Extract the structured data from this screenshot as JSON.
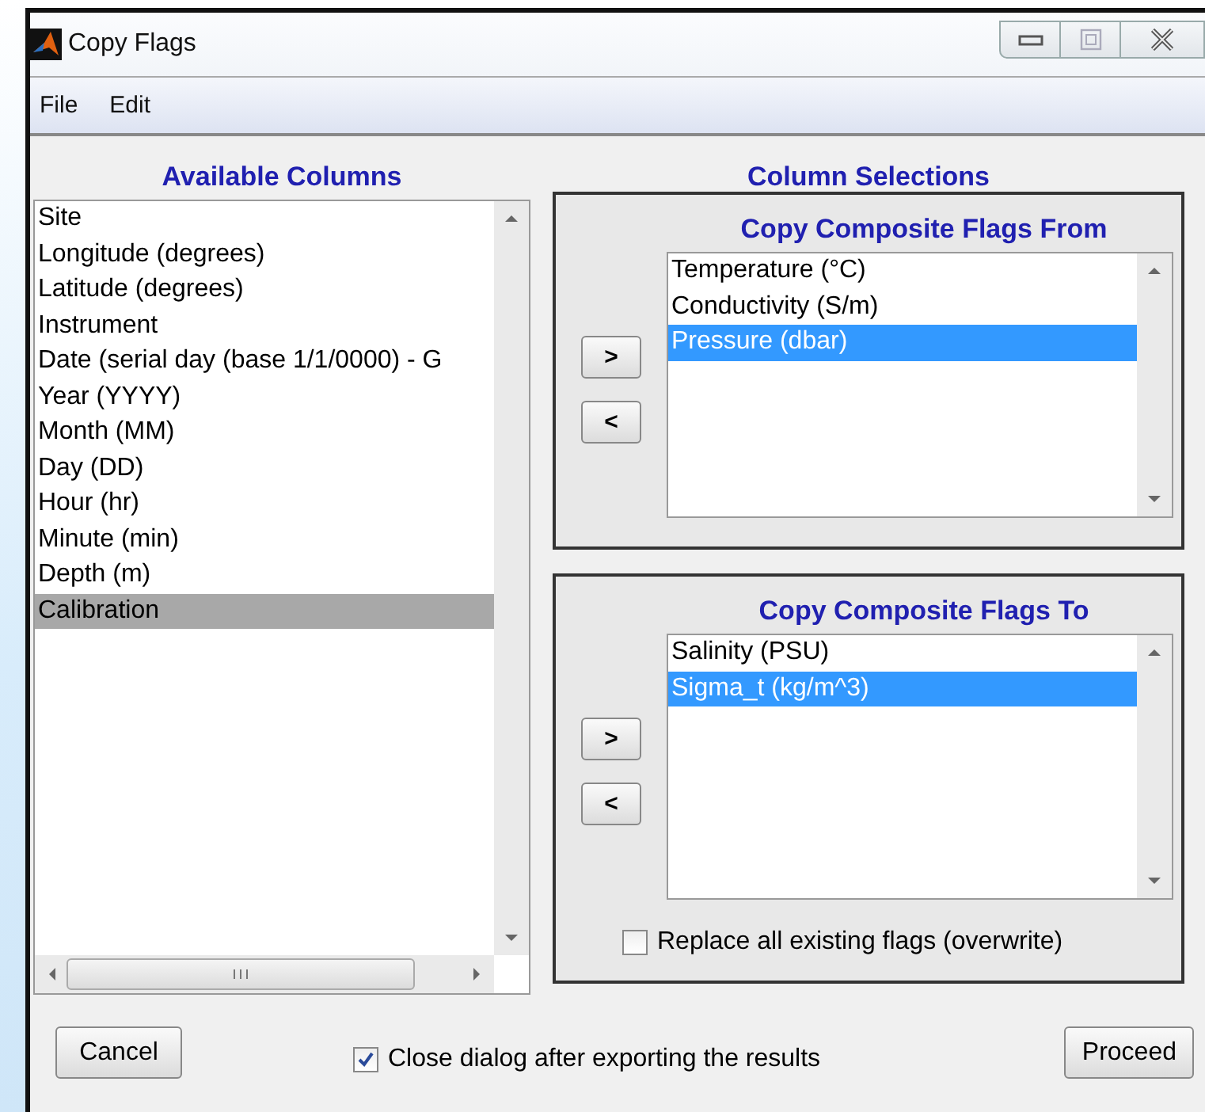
{
  "window": {
    "title": "Copy Flags"
  },
  "menu": [
    "File",
    "Edit"
  ],
  "available": {
    "heading": "Available Columns",
    "items": [
      {
        "label": "Site",
        "selected": false
      },
      {
        "label": "Longitude (degrees)",
        "selected": false
      },
      {
        "label": "Latitude (degrees)",
        "selected": false
      },
      {
        "label": "Instrument",
        "selected": false
      },
      {
        "label": "Date (serial day (base 1/1/0000) - G",
        "selected": false
      },
      {
        "label": "Year (YYYY)",
        "selected": false
      },
      {
        "label": "Month (MM)",
        "selected": false
      },
      {
        "label": "Day (DD)",
        "selected": false
      },
      {
        "label": "Hour (hr)",
        "selected": false
      },
      {
        "label": "Minute (min)",
        "selected": false
      },
      {
        "label": "Depth (m)",
        "selected": false
      },
      {
        "label": "Calibration",
        "selected": true
      }
    ]
  },
  "selections": {
    "heading": "Column Selections",
    "panels": [
      {
        "heading": "Copy Composite Flags From",
        "add": ">",
        "remove": "<",
        "items": [
          {
            "label": "Temperature (°C)",
            "selected": false
          },
          {
            "label": "Conductivity (S/m)",
            "selected": false
          },
          {
            "label": "Pressure (dbar)",
            "selected": true
          }
        ]
      },
      {
        "heading": "Copy Composite Flags To",
        "add": ">",
        "remove": "<",
        "items": [
          {
            "label": "Salinity (PSU)",
            "selected": false
          },
          {
            "label": "Sigma_t (kg/m^3)",
            "selected": true
          }
        ],
        "option": {
          "label": "Replace all existing flags (overwrite)",
          "checked": false
        }
      }
    ]
  },
  "footer": {
    "cancel": "Cancel",
    "close_option": {
      "label": "Close dialog after exporting the results",
      "checked": true
    },
    "proceed": "Proceed"
  }
}
